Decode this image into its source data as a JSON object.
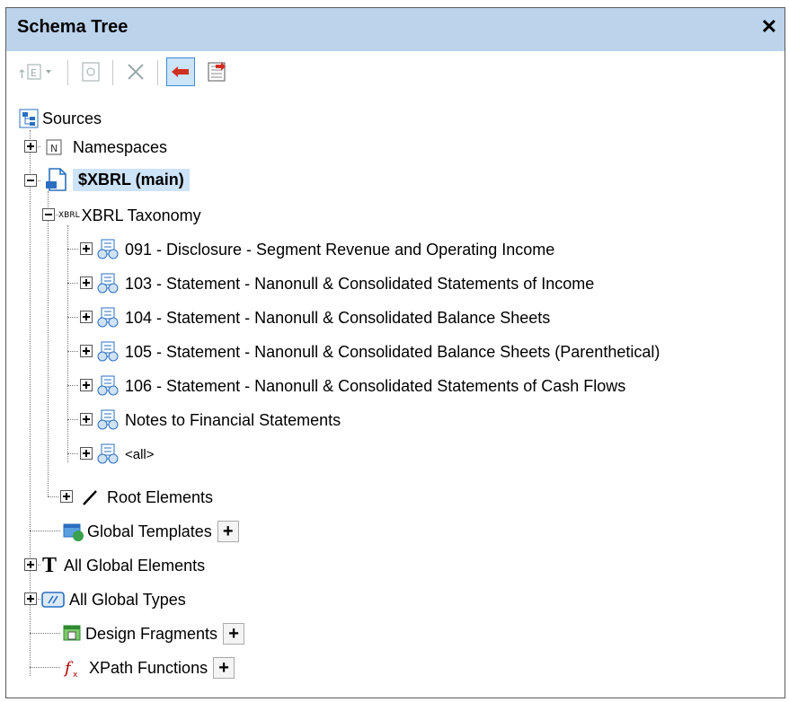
{
  "panel": {
    "title": "Schema Tree",
    "close_glyph": "✕"
  },
  "toolbar": {
    "buttons": [
      "add-element-dropdown",
      "properties",
      "delete",
      "show-in-design",
      "import-schema"
    ]
  },
  "tree": {
    "sources_label": "Sources",
    "namespaces_label": "Namespaces",
    "main_label": "$XBRL (main)",
    "taxonomy_label": "XBRL Taxonomy",
    "taxonomy_prefix": "XBRL",
    "linkroles": [
      "091 - Disclosure - Segment Revenue and Operating Income",
      "103 - Statement - Nanonull & Consolidated Statements of Income",
      "104 - Statement - Nanonull & Consolidated Balance Sheets",
      "105 - Statement - Nanonull & Consolidated Balance Sheets (Parenthetical)",
      "106 - Statement - Nanonull & Consolidated Statements of Cash Flows",
      "Notes to Financial Statements",
      "<all>"
    ],
    "root_elements_label": "Root Elements",
    "global_templates_label": "Global Templates",
    "all_global_elements_label": "All Global Elements",
    "all_global_types_label": "All Global Types",
    "design_fragments_label": "Design Fragments",
    "xpath_functions_label": "XPath Functions",
    "add_glyph": "+"
  },
  "colors": {
    "title_bg": "#bcd3ec",
    "selected_bg": "#cde3f8",
    "active_button": "#3c8ad8"
  }
}
